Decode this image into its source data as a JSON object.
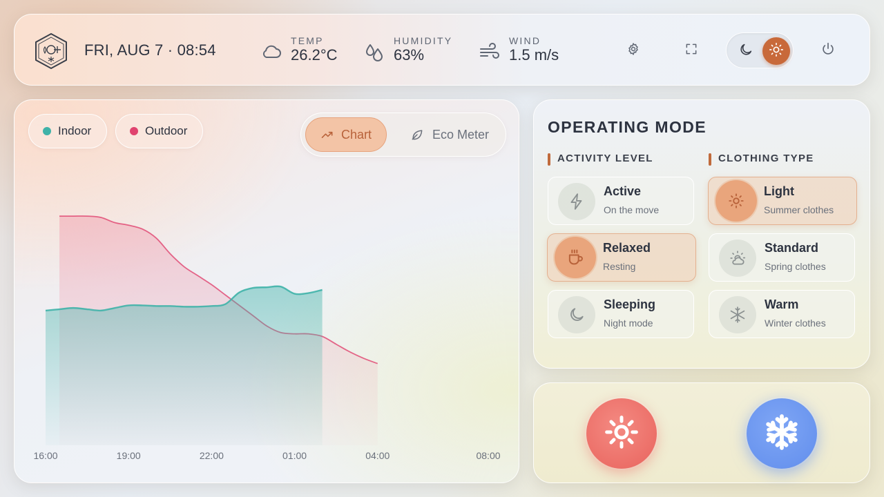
{
  "header": {
    "datetime": "FRI, AUG 7 · 08:54",
    "metrics": [
      {
        "label": "TEMP",
        "value": "26.2°C",
        "icon": "cloud-icon"
      },
      {
        "label": "HUMIDITY",
        "value": "63%",
        "icon": "droplets-icon"
      },
      {
        "label": "WIND",
        "value": "1.5 m/s",
        "icon": "wind-icon"
      }
    ],
    "buttons": [
      "gear-icon",
      "fullscreen-icon",
      "power-icon"
    ],
    "theme": {
      "active": "light",
      "options": [
        "moon-icon",
        "sun-icon"
      ]
    }
  },
  "chart_panel": {
    "legend": [
      {
        "label": "Indoor",
        "color": "#3fb2a8"
      },
      {
        "label": "Outdoor",
        "color": "#e0436f"
      }
    ],
    "view_switch": {
      "chart_label": "Chart",
      "eco_label": "Eco Meter",
      "active": "chart"
    }
  },
  "chart_data": {
    "type": "area",
    "x_ticks": [
      "16:00",
      "19:00",
      "22:00",
      "01:00",
      "04:00",
      "08:00"
    ],
    "x": [
      "16:00",
      "16:30",
      "17:00",
      "17:30",
      "18:00",
      "18:30",
      "19:00",
      "19:30",
      "20:00",
      "20:30",
      "21:00",
      "21:30",
      "22:00",
      "22:30",
      "23:00",
      "23:30",
      "00:00",
      "00:30",
      "01:00",
      "01:30",
      "02:00",
      "02:30",
      "03:00",
      "03:30",
      "04:00"
    ],
    "series": [
      {
        "name": "Indoor",
        "color": "#3fb2a8",
        "values": [
          24.2,
          24.3,
          24.4,
          24.3,
          24.2,
          24.4,
          24.6,
          24.6,
          24.55,
          24.55,
          24.5,
          24.5,
          24.55,
          24.7,
          25.6,
          25.95,
          26.0,
          26.05,
          25.5,
          25.55,
          25.8,
          null,
          null,
          null,
          null
        ]
      },
      {
        "name": "Outdoor",
        "color": "#e0436f",
        "values": [
          null,
          31.5,
          31.5,
          31.5,
          31.4,
          31.0,
          30.8,
          30.5,
          29.8,
          28.6,
          27.6,
          26.9,
          26.2,
          25.4,
          24.6,
          23.8,
          23.0,
          22.5,
          22.4,
          22.4,
          22.2,
          21.6,
          21.0,
          20.5,
          20.1
        ]
      }
    ],
    "ylim": [
      14,
      33
    ],
    "grid": false,
    "legend": "top-left"
  },
  "mode": {
    "title": "OPERATING MODE",
    "activity": {
      "heading": "ACTIVITY LEVEL",
      "options": [
        {
          "title": "Active",
          "subtitle": "On the move",
          "icon": "bolt-icon",
          "selected": false
        },
        {
          "title": "Relaxed",
          "subtitle": "Resting",
          "icon": "coffee-cup-icon",
          "selected": true
        },
        {
          "title": "Sleeping",
          "subtitle": "Night mode",
          "icon": "moon-icon",
          "selected": false
        }
      ]
    },
    "clothing": {
      "heading": "CLOTHING TYPE",
      "options": [
        {
          "title": "Light",
          "subtitle": "Summer clothes",
          "icon": "sun-icon",
          "selected": true
        },
        {
          "title": "Standard",
          "subtitle": "Spring clothes",
          "icon": "sun-behind-cloud-icon",
          "selected": false
        },
        {
          "title": "Warm",
          "subtitle": "Winter clothes",
          "icon": "snowflake-icon",
          "selected": false
        }
      ]
    }
  },
  "actions": [
    {
      "name": "heat",
      "icon": "sun-icon",
      "color": "#ec6f68"
    },
    {
      "name": "cool",
      "icon": "snowflake-icon",
      "color": "#6a95ef"
    }
  ]
}
